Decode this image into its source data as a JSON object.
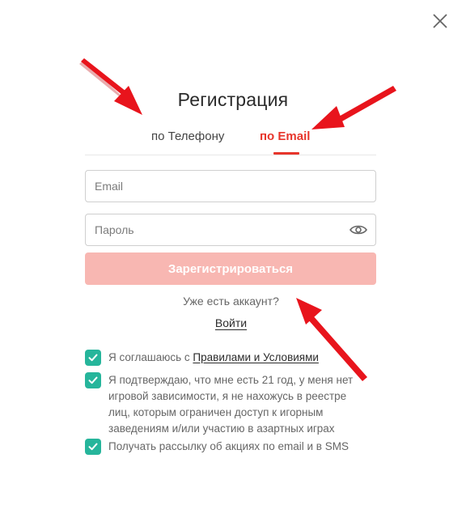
{
  "modal": {
    "title": "Регистрация",
    "close_icon": "close-icon"
  },
  "tabs": [
    {
      "label": "по Телефону",
      "active": false
    },
    {
      "label": "по Email",
      "active": true
    }
  ],
  "form": {
    "email_placeholder": "Email",
    "email_value": "",
    "password_placeholder": "Пароль",
    "password_value": "",
    "show_password_icon": "eye-icon",
    "submit_label": "Зарегистрироваться",
    "submit_enabled": false
  },
  "login": {
    "prompt": "Уже есть аккаунт?",
    "link_label": "Войти"
  },
  "consents": [
    {
      "checked": true,
      "text_prefix": "Я соглашаюсь с ",
      "link_text": "Правилами и Условиями"
    },
    {
      "checked": true,
      "text": "Я подтверждаю, что мне есть 21 год, у меня нет игровой зависимости, я не нахожусь в реестре лиц, которым ограничен доступ к игорным заведениям и/или участию в азартных играх"
    },
    {
      "checked": true,
      "text": "Получать рассылку об акциях по email и в SMS"
    }
  ],
  "colors": {
    "accent": "#e7352b",
    "checkbox": "#26b59b",
    "submit_disabled": "#f8b7b2",
    "annotation_arrow": "#e8141c"
  }
}
